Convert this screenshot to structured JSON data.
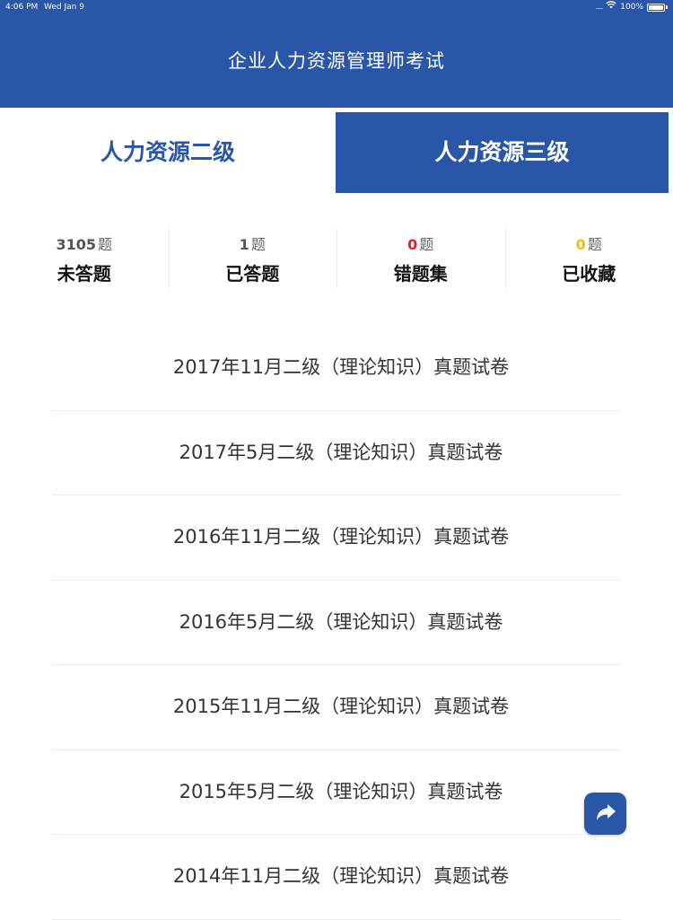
{
  "status_bar": {
    "time": "4:06 PM",
    "date": "Wed Jan 9",
    "signal": ".....",
    "battery": "100%"
  },
  "header": {
    "title": "企业人力资源管理师考试"
  },
  "tabs": [
    {
      "label": "人力资源二级",
      "active": true
    },
    {
      "label": "人力资源三级",
      "active": false
    }
  ],
  "stats": [
    {
      "count": "3105",
      "unit": "题",
      "label": "未答题",
      "color": "#555555"
    },
    {
      "count": "1",
      "unit": "题",
      "label": "已答题",
      "color": "#555555"
    },
    {
      "count": "0",
      "unit": "题",
      "label": "错题集",
      "color": "#e02020"
    },
    {
      "count": "0",
      "unit": "题",
      "label": "已收藏",
      "color": "#f2c00c"
    }
  ],
  "exams": [
    "2017年11月二级（理论知识）真题试卷",
    "2017年5月二级（理论知识）真题试卷",
    "2016年11月二级（理论知识）真题试卷",
    "2016年5月二级（理论知识）真题试卷",
    "2015年11月二级（理论知识）真题试卷",
    "2015年5月二级（理论知识）真题试卷",
    "2014年11月二级（理论知识）真题试卷"
  ],
  "share_button": {
    "icon": "share-arrow-icon"
  },
  "colors": {
    "primary": "#2a56a8",
    "wrong": "#e02020",
    "favorite": "#f2c00c"
  }
}
